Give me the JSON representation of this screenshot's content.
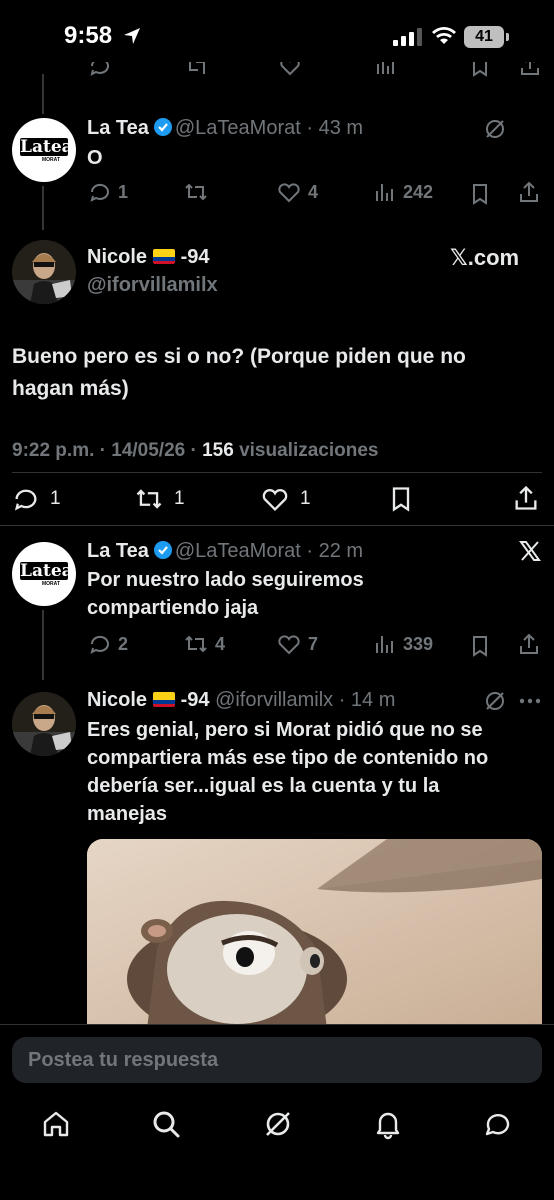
{
  "status_bar": {
    "time": "9:58",
    "battery": "41"
  },
  "thread": {
    "tweet1": {
      "name": "La Tea",
      "handle": "@LaTeaMorat",
      "time": "· 43 m",
      "text": "O",
      "replies": "1",
      "retweets": "",
      "likes": "4",
      "views": "242",
      "avatar_text": "Lateа",
      "avatar_sub": "MORAT"
    },
    "main_tweet": {
      "name": "Nicole",
      "name_suffix": "-94",
      "handle": "@iforvillamilx",
      "source_badge": "𝕏.com",
      "text_line1": "Bueno pero es si o no? (Porque piden que no",
      "text_line2": "hagan más)",
      "timestamp": "9:22 p.m. · 14/05/26 · ",
      "views_count": "156",
      "views_label": " visualizaciones",
      "replies": "1",
      "retweets": "1",
      "likes": "1"
    },
    "reply1": {
      "name": "La Tea",
      "handle": "@LaTeaMorat",
      "time": "· 22 m",
      "text_line1": "Por nuestro lado seguiremos",
      "text_line2": "compartiendo jaja",
      "replies": "2",
      "retweets": "4",
      "likes": "7",
      "views": "339"
    },
    "reply2": {
      "name": "Nicole",
      "name_suffix": "-94",
      "handle": "@iforvillamilx",
      "time": "· 14 m",
      "text_line1": "Eres genial, pero si Morat pidió que no se",
      "text_line2": "compartiera más ese tipo de contenido no",
      "text_line3": "debería ser...igual es la cuenta y tu la",
      "text_line4": "manejas"
    }
  },
  "reply_input": {
    "placeholder": "Postea tu respuesta"
  },
  "tab_bar": [
    "home-icon",
    "search-icon",
    "grok-icon",
    "notifications-icon",
    "messages-icon"
  ],
  "colors": {
    "background": "#000000",
    "text": "#e7e9ea",
    "muted": "#71767b",
    "verified": "#1d9bf0"
  }
}
